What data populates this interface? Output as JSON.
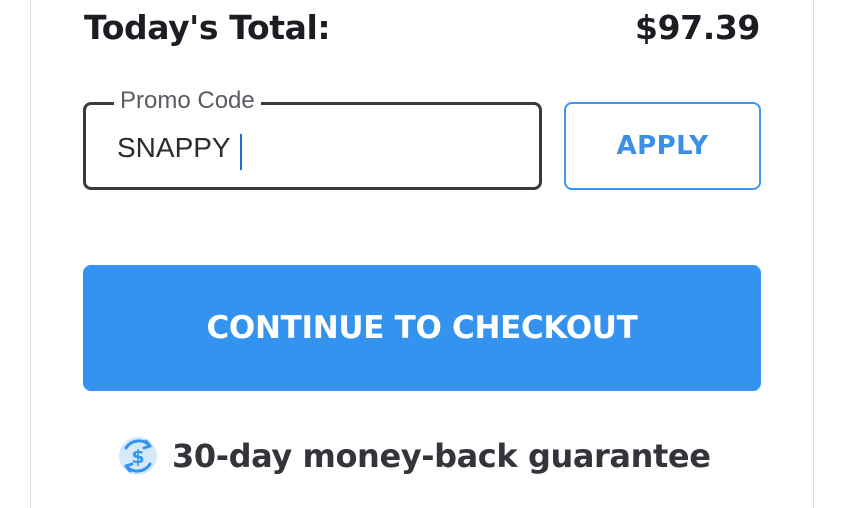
{
  "summary": {
    "total_label": "Today's Total:",
    "total_value": "$97.39"
  },
  "promo": {
    "label": "Promo Code",
    "value": "SNAPPY",
    "apply_label": "APPLY"
  },
  "checkout": {
    "button_label": "CONTINUE TO CHECKOUT"
  },
  "guarantee": {
    "text": "30-day money-back guarantee",
    "icon": "dollar-refresh-icon"
  },
  "colors": {
    "accent": "#3493ee",
    "text_dark": "#1c1d22",
    "input_border": "#3a3b40"
  }
}
